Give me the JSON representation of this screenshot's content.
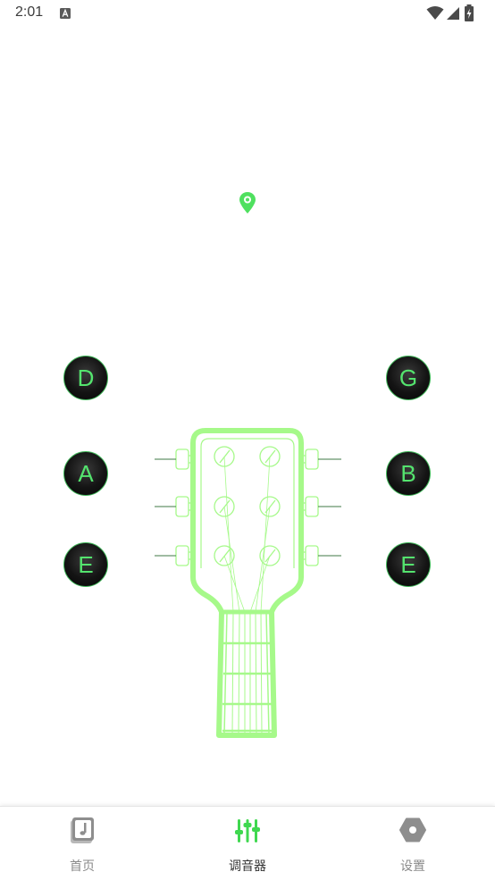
{
  "status_bar": {
    "time": "2:01",
    "left_icon": "keyboard-a-icon",
    "right_icons": [
      "wifi-icon",
      "signal-icon",
      "battery-charging-icon"
    ]
  },
  "tuner": {
    "accent_color": "#54e46e",
    "headstock_color": "#a6f98a",
    "pin_icon": "location-pin-icon",
    "strings_left": [
      "D",
      "A",
      "E"
    ],
    "strings_right": [
      "G",
      "B",
      "E"
    ]
  },
  "bottom_nav": {
    "items": [
      {
        "label": "首页",
        "icon": "music-note-book-icon",
        "active": false
      },
      {
        "label": "调音器",
        "icon": "tuner-sliders-icon",
        "active": true
      },
      {
        "label": "设置",
        "icon": "hexagon-settings-icon",
        "active": false
      }
    ]
  }
}
